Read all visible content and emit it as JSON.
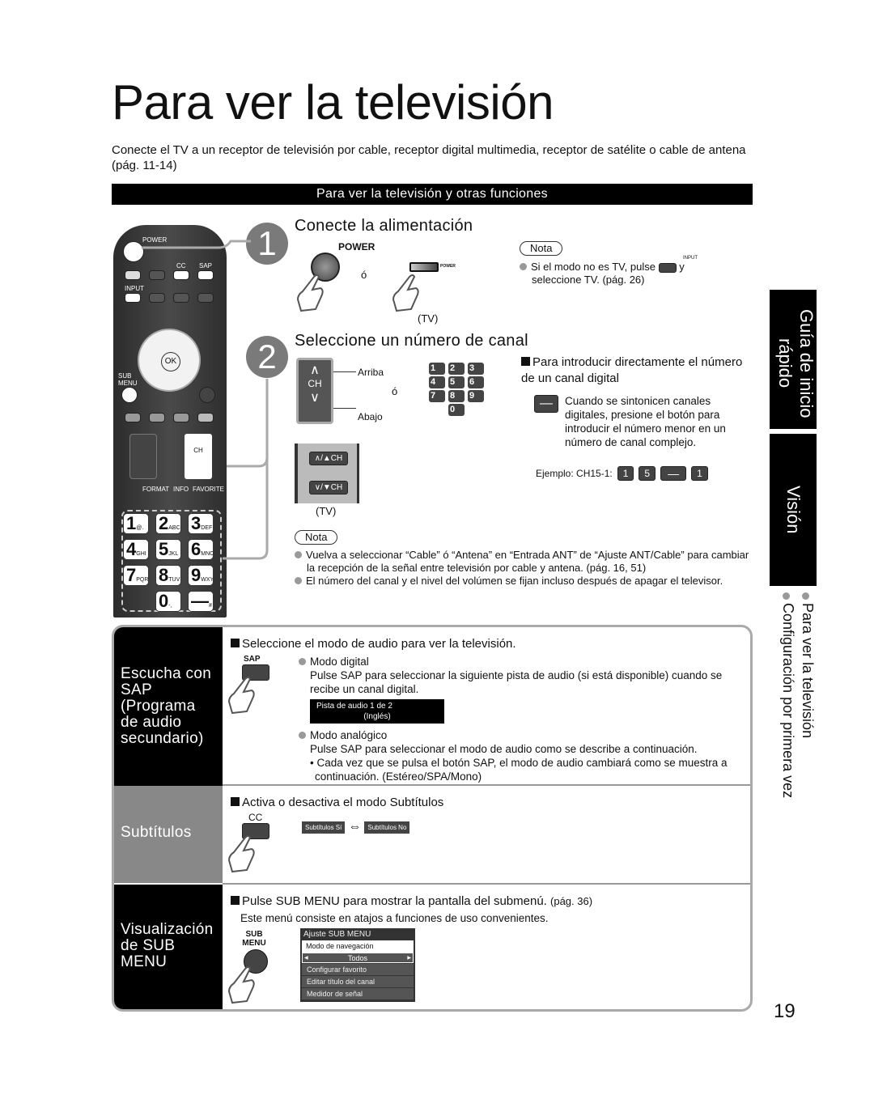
{
  "page": {
    "title": "Para ver la televisión",
    "intro": "Conecte el TV a un receptor de televisión por cable, receptor digital multimedia, receptor de satélite o cable de antena (pág. 11-14)",
    "section_bar": "Para ver la televisión y otras funciones",
    "page_number": "19"
  },
  "remote": {
    "power_label": "POWER",
    "cc_label": "CC",
    "sap_label": "SAP",
    "input_label": "INPUT",
    "ok_label": "OK",
    "sub_menu_label": "SUB MENU",
    "ch_label": "CH",
    "format_label": "FORMAT",
    "info_label": "INFO",
    "favorite_label": "FAVORITE",
    "keys": [
      {
        "num": "1",
        "sub": "@."
      },
      {
        "num": "2",
        "sub": "ABC"
      },
      {
        "num": "3",
        "sub": "DEF"
      },
      {
        "num": "4",
        "sub": "GHI"
      },
      {
        "num": "5",
        "sub": "JKL"
      },
      {
        "num": "6",
        "sub": "MNO"
      },
      {
        "num": "7",
        "sub": "PQRS"
      },
      {
        "num": "8",
        "sub": "TUV"
      },
      {
        "num": "9",
        "sub": "WXYZ"
      },
      {
        "num": "0",
        "sub": "-,"
      },
      {
        "num": "—",
        "sub": "#"
      }
    ]
  },
  "step1": {
    "number": "1",
    "heading": "Conecte la alimentación",
    "power_label": "POWER",
    "or": "ó",
    "tv_power_small": "POWER",
    "tv_label": "(TV)",
    "nota_label": "Nota",
    "note_input_label": "INPUT",
    "note_text_a": "Si el modo no es TV, pulse",
    "note_text_b": "y",
    "note_text_c": "seleccione TV. (pág. 26)"
  },
  "step2": {
    "number": "2",
    "heading": "Seleccione un número de canal",
    "ch_label": "CH",
    "arriba": "Arriba",
    "abajo": "Abajo",
    "or": "ó",
    "tv_up": "∧/▲CH",
    "tv_down": "∨/▼CH",
    "tv_label": "(TV)",
    "keypad": [
      "1",
      "2",
      "3",
      "4",
      "5",
      "6",
      "7",
      "8",
      "9",
      "0"
    ],
    "direct_heading": "Para introducir directamente el número de un canal digital",
    "direct_text": "Cuando se sintonicen canales digitales, presione el botón para introducir el número menor en un número de canal complejo.",
    "example_label": "Ejemplo:  CH15-1:",
    "example_keys": [
      "1",
      "5",
      "—",
      "1"
    ],
    "nota_label": "Nota",
    "notes": [
      "Vuelva a seleccionar “Cable” ó “Antena” en “Entrada ANT” de “Ajuste ANT/Cable” para cambiar la recepción de la señal entre televisión por cable y antena. (pág. 16, 51)",
      "El número del canal y el nivel del volúmen se fijan incluso después de apagar el televisor."
    ]
  },
  "sidebar": {
    "tab1": "Guía de inicio rápido",
    "tab2": "Visión",
    "link1": "Para ver la televisión",
    "link2": "Configuración por primera vez"
  },
  "sap_section": {
    "label": "Escucha con SAP (Programa de audio secundario)",
    "heading": "Seleccione el modo de audio para ver la televisión.",
    "button_label": "SAP",
    "digital_title": "Modo digital",
    "digital_text": "Pulse SAP para seleccionar la siguiente pista de audio (si está disponible) cuando se recibe un canal digital.",
    "osd_line1": "Pista de audio 1 de 2",
    "osd_line2": "(Inglés)",
    "analog_title": "Modo analógico",
    "analog_text": "Pulse SAP para seleccionar el modo de audio como se describe a continuación.",
    "analog_bullet": "• Cada vez que se pulsa el botón SAP, el modo de audio cambiará como se muestra a continuación. (Estéreo/SPA/Mono)"
  },
  "cc_section": {
    "label": "Subtítulos",
    "heading": "Activa o desactiva el modo Subtítulos",
    "button_label": "CC",
    "osd_on": "Subtítulos Sí",
    "osd_off": "Subtítulos No",
    "arrow": "⇔"
  },
  "submenu_section": {
    "label": "Visualización de SUB MENU",
    "heading": "Pulse SUB MENU para mostrar la pantalla del submenú.",
    "heading_ref": "(pág. 36)",
    "text": "Este menú consiste en atajos a funciones de uso convenientes.",
    "button_label": "SUB MENU",
    "menu_title": "Ajuste SUB MENU",
    "menu_selected": "Modo de navegación",
    "menu_value": "Todos",
    "menu_items": [
      "Configurar favorito",
      "Editar título del canal",
      "Medidor de señal"
    ]
  }
}
